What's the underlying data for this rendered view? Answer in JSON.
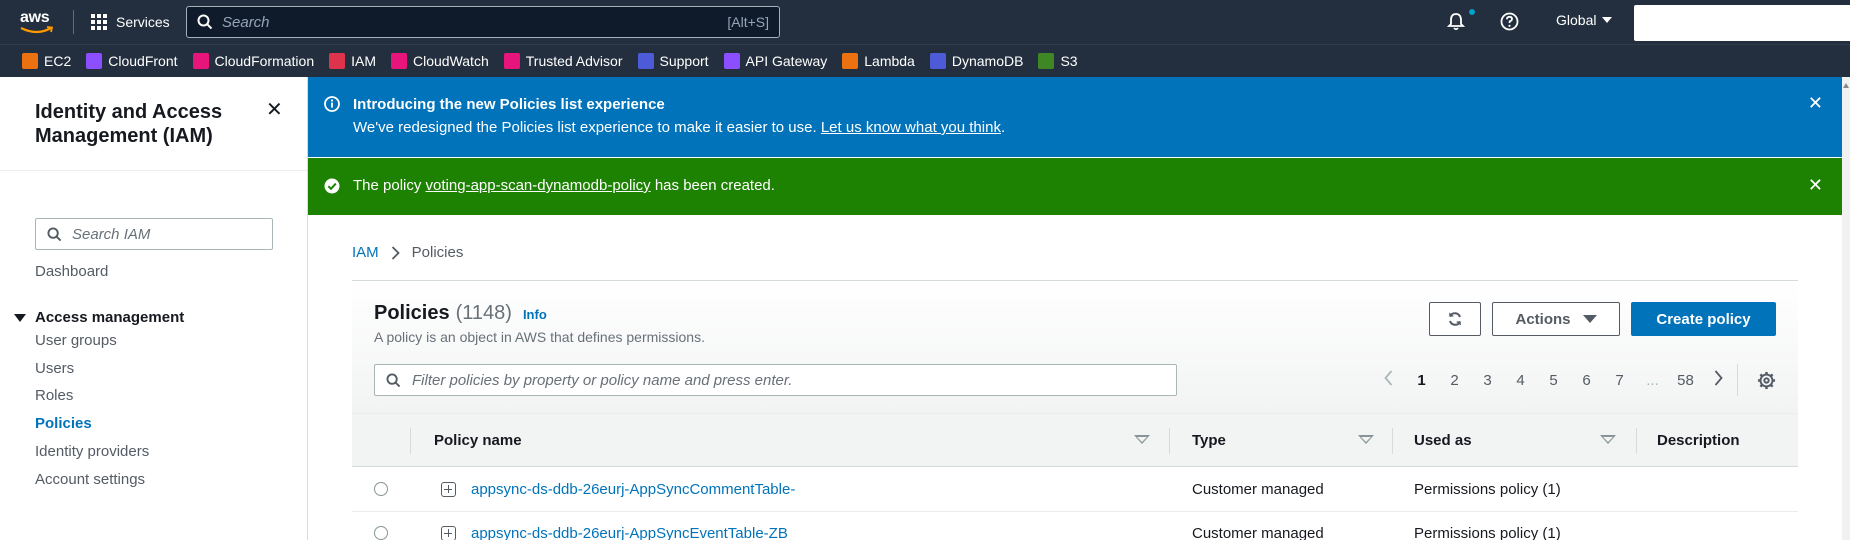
{
  "topnav": {
    "logo_text": "aws",
    "services_label": "Services",
    "search_placeholder": "Search",
    "search_shortcut": "[Alt+S]",
    "region_label": "Global"
  },
  "favorites": [
    {
      "label": "EC2",
      "icon": "ec2-icon",
      "color": "#ec7211"
    },
    {
      "label": "CloudFront",
      "icon": "cloudfront-icon",
      "color": "#8c4fff"
    },
    {
      "label": "CloudFormation",
      "icon": "cloudformation-icon",
      "color": "#e7157b"
    },
    {
      "label": "IAM",
      "icon": "iam-icon",
      "color": "#dd344c"
    },
    {
      "label": "CloudWatch",
      "icon": "cloudwatch-icon",
      "color": "#e7157b"
    },
    {
      "label": "Trusted Advisor",
      "icon": "trusted-advisor-icon",
      "color": "#e7157b"
    },
    {
      "label": "Support",
      "icon": "support-icon",
      "color": "#4d5bd8"
    },
    {
      "label": "API Gateway",
      "icon": "api-gateway-icon",
      "color": "#8c4fff"
    },
    {
      "label": "Lambda",
      "icon": "lambda-icon",
      "color": "#ec7211"
    },
    {
      "label": "DynamoDB",
      "icon": "dynamodb-icon",
      "color": "#4d5bd8"
    },
    {
      "label": "S3",
      "icon": "s3-icon",
      "color": "#3f8624"
    }
  ],
  "sidebar": {
    "title": "Identity and Access Management (IAM)",
    "search_placeholder": "Search IAM",
    "dashboard": "Dashboard",
    "section": "Access management",
    "items": [
      {
        "label": "User groups",
        "active": false
      },
      {
        "label": "Users",
        "active": false
      },
      {
        "label": "Roles",
        "active": false
      },
      {
        "label": "Policies",
        "active": true
      },
      {
        "label": "Identity providers",
        "active": false
      },
      {
        "label": "Account settings",
        "active": false
      }
    ]
  },
  "flash_info": {
    "heading": "Introducing the new Policies list experience",
    "body": "We've redesigned the Policies list experience to make it easier to use.",
    "link": "Let us know what you think",
    "tail": "."
  },
  "flash_success": {
    "prefix": "The policy",
    "policy_link": "voting-app-scan-dynamodb-policy",
    "suffix": "has been created."
  },
  "breadcrumb": {
    "root": "IAM",
    "current": "Policies"
  },
  "policies": {
    "title": "Policies",
    "count": "(1148)",
    "info_link": "Info",
    "description": "A policy is an object in AWS that defines permissions.",
    "actions_label": "Actions",
    "create_label": "Create policy",
    "filter_placeholder": "Filter policies by property or policy name and press enter.",
    "pagination": {
      "pages": [
        "1",
        "2",
        "3",
        "4",
        "5",
        "6",
        "7"
      ],
      "current": "1",
      "ellipsis": "...",
      "last": "58"
    },
    "columns": {
      "name": "Policy name",
      "type": "Type",
      "used_as": "Used as",
      "description": "Description"
    },
    "rows": [
      {
        "name": "appsync-ds-ddb-26eurj-AppSyncCommentTable-",
        "type": "Customer managed",
        "used_as": "Permissions policy (1)"
      },
      {
        "name": "appsync-ds-ddb-26eurj-AppSyncEventTable-ZB",
        "type": "Customer managed",
        "used_as": "Permissions policy (1)"
      }
    ]
  }
}
